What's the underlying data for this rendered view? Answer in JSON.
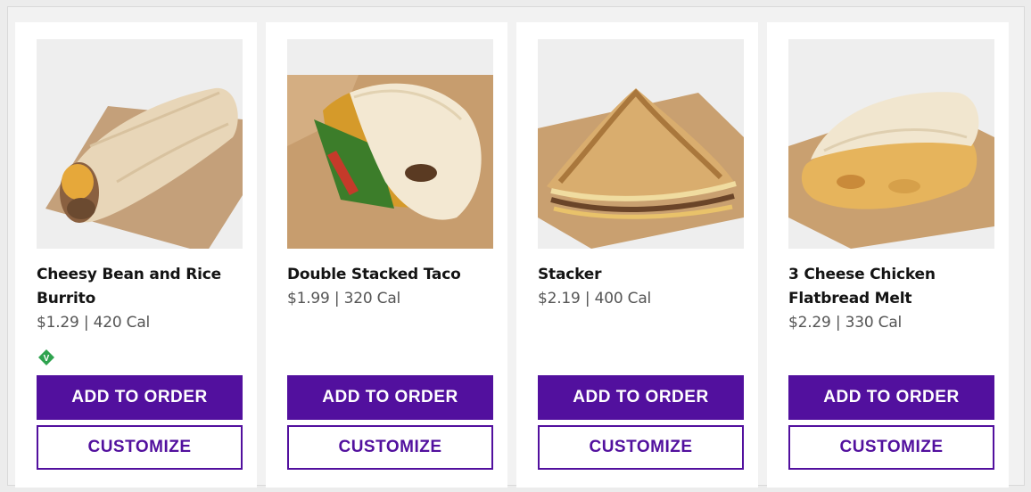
{
  "colors": {
    "primary": "#52109e",
    "vegetarian_badge": "#2fa34f"
  },
  "products": [
    {
      "name": "Cheesy Bean and Rice Burrito",
      "price_cal": "$1.29 | 420 Cal",
      "badge_icon": "vegetarian-badge-icon",
      "badge_text": "V",
      "add_label": "ADD TO ORDER",
      "customize_label": "CUSTOMIZE"
    },
    {
      "name": "Double Stacked Taco",
      "price_cal": "$1.99 | 320 Cal",
      "add_label": "ADD TO ORDER",
      "customize_label": "CUSTOMIZE"
    },
    {
      "name": "Stacker",
      "price_cal": "$2.19 | 400 Cal",
      "add_label": "ADD TO ORDER",
      "customize_label": "CUSTOMIZE"
    },
    {
      "name": "3 Cheese Chicken Flatbread Melt",
      "price_cal": "$2.29 | 330 Cal",
      "add_label": "ADD TO ORDER",
      "customize_label": "CUSTOMIZE"
    }
  ]
}
